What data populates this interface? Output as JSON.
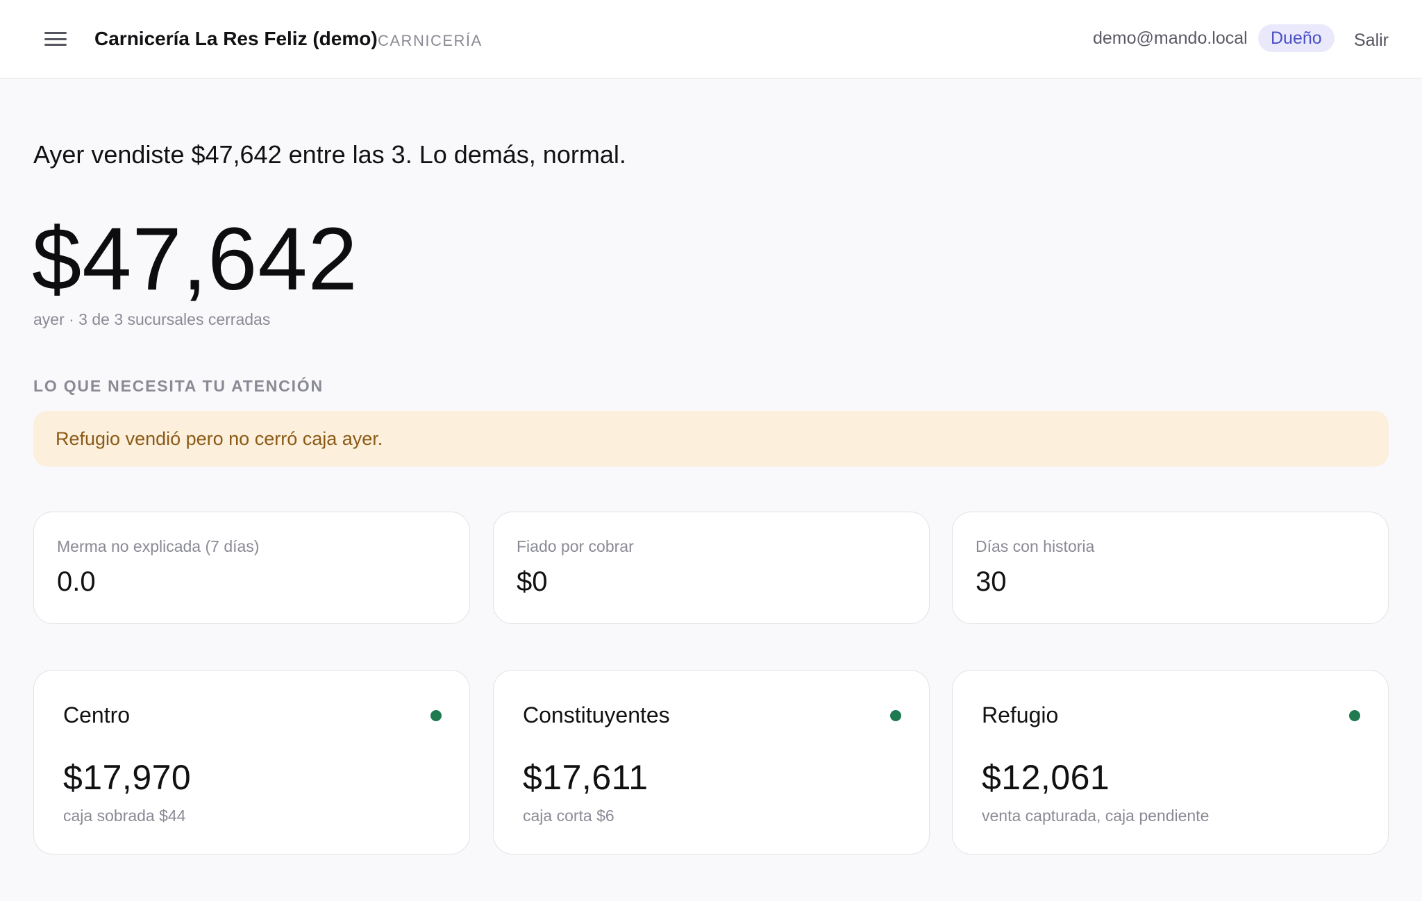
{
  "header": {
    "business_name": "Carnicería La Res Feliz (demo)",
    "business_type": "CARNICERÍA",
    "user_email": "demo@mando.local",
    "role": "Dueño",
    "logout_label": "Salir",
    "menu_icon": "hamburger-menu-icon"
  },
  "summary": {
    "headline": "Ayer vendiste $47,642 entre las 3. Lo demás, normal.",
    "total": "$47,642",
    "caption": "ayer · 3 de 3 sucursales cerradas"
  },
  "attention": {
    "title": "LO QUE NECESITA TU ATENCIÓN",
    "alert": "Refugio vendió pero no cerró caja ayer."
  },
  "kpis": [
    {
      "label": "Merma no explicada (7 días)",
      "value": "0.0"
    },
    {
      "label": "Fiado por cobrar",
      "value": "$0"
    },
    {
      "label": "Días con historia",
      "value": "30"
    }
  ],
  "branches": [
    {
      "name": "Centro",
      "amount": "$17,970",
      "note": "caja sobrada $44",
      "status_color": "#1f7a4f"
    },
    {
      "name": "Constituyentes",
      "amount": "$17,611",
      "note": "caja corta $6",
      "status_color": "#1f7a4f"
    },
    {
      "name": "Refugio",
      "amount": "$12,061",
      "note": "venta capturada, caja pendiente",
      "status_color": "#1f7a4f"
    }
  ],
  "colors": {
    "accent": "#4a4fc4",
    "alert_bg": "#fcefdc",
    "alert_text": "#8a5a16",
    "status_ok": "#1f7a4f"
  }
}
